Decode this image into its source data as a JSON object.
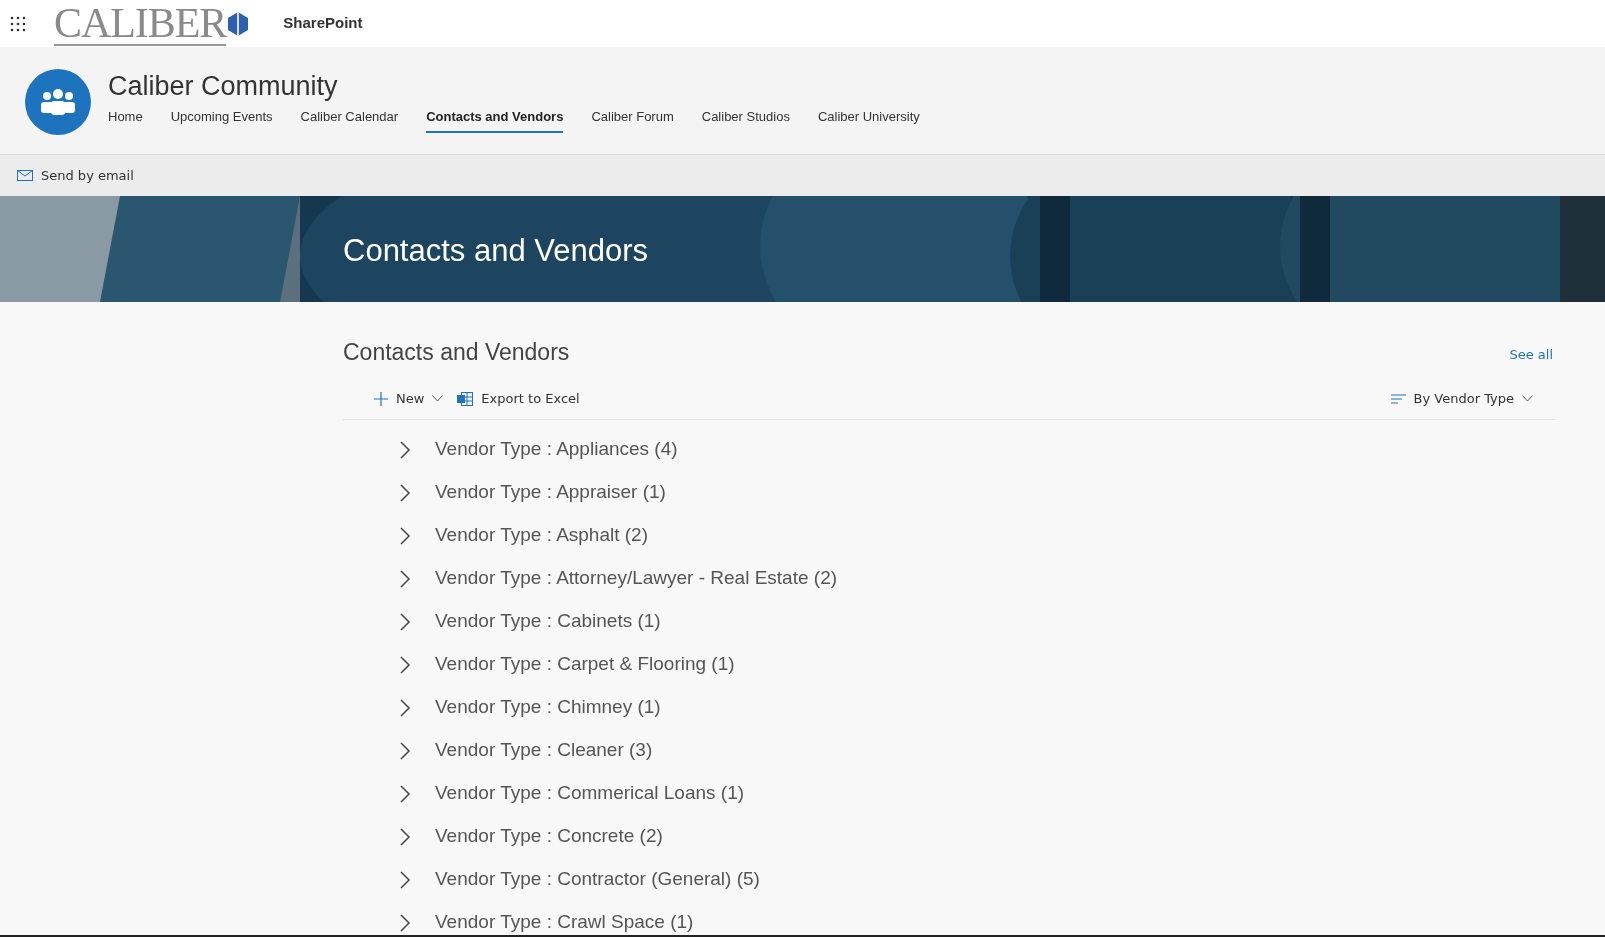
{
  "top_bar": {
    "logo": "CALIBER",
    "app_name": "SharePoint"
  },
  "site": {
    "title": "Caliber Community",
    "nav": [
      {
        "label": "Home",
        "selected": false
      },
      {
        "label": "Upcoming Events",
        "selected": false
      },
      {
        "label": "Caliber Calendar",
        "selected": false
      },
      {
        "label": "Contacts and Vendors",
        "selected": true
      },
      {
        "label": "Caliber Forum",
        "selected": false
      },
      {
        "label": "Caliber Studios",
        "selected": false
      },
      {
        "label": "Caliber University",
        "selected": false
      }
    ]
  },
  "command_bar": {
    "action": "Send by email"
  },
  "banner": {
    "title": "Contacts and Vendors"
  },
  "list": {
    "title": "Contacts and Vendors",
    "see_all": "See all",
    "new_button": "New",
    "export_button": "Export to Excel",
    "view": "By Vendor Type",
    "groups": [
      {
        "label": "Vendor Type : Appliances (4)",
        "expanded": false
      },
      {
        "label": "Vendor Type : Appraiser (1)",
        "expanded": false
      },
      {
        "label": "Vendor Type : Asphalt (2)",
        "expanded": false
      },
      {
        "label": "Vendor Type : Attorney/Lawyer - Real Estate (2)",
        "expanded": false
      },
      {
        "label": "Vendor Type : Cabinets (1)",
        "expanded": false
      },
      {
        "label": "Vendor Type : Carpet & Flooring (1)",
        "expanded": false
      },
      {
        "label": "Vendor Type : Chimney (1)",
        "expanded": false
      },
      {
        "label": "Vendor Type : Cleaner (3)",
        "expanded": false
      },
      {
        "label": "Vendor Type : Commerical Loans (1)",
        "expanded": false
      },
      {
        "label": "Vendor Type : Concrete (2)",
        "expanded": false
      },
      {
        "label": "Vendor Type : Contractor (General) (5)",
        "expanded": false
      },
      {
        "label": "Vendor Type : Crawl Space (1)",
        "expanded": false
      }
    ]
  }
}
